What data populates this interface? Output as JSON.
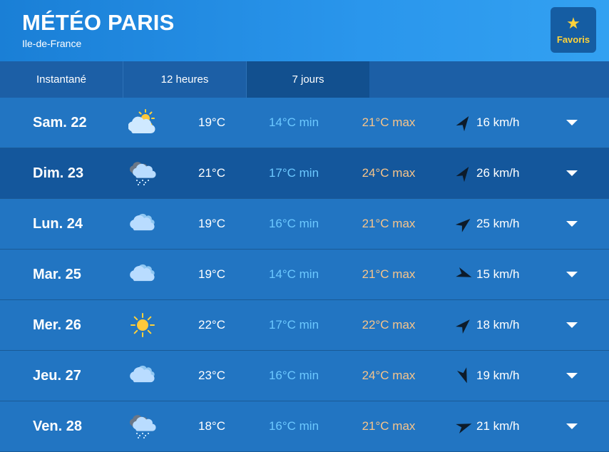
{
  "header": {
    "title": "MÉTÉO PARIS",
    "subtitle": "Ile-de-France",
    "favorite_label": "Favoris",
    "favorite_color": "#ffd23a"
  },
  "tabs": [
    {
      "label": "Instantané",
      "active": false
    },
    {
      "label": "12 heures",
      "active": false
    },
    {
      "label": "7 jours",
      "active": true
    }
  ],
  "days": [
    {
      "day": "Sam. 22",
      "icon": "sun-cloud-icon",
      "temp": "19°C",
      "min": "14°C min",
      "max": "21°C max",
      "wind": "16 km/h",
      "wind_dir_deg": 35
    },
    {
      "day": "Dim. 23",
      "icon": "cloud-rain-icon",
      "temp": "21°C",
      "min": "17°C min",
      "max": "24°C max",
      "wind": "26 km/h",
      "wind_dir_deg": 35
    },
    {
      "day": "Lun. 24",
      "icon": "cloud-icon",
      "temp": "19°C",
      "min": "16°C min",
      "max": "21°C max",
      "wind": "25 km/h",
      "wind_dir_deg": 50
    },
    {
      "day": "Mar. 25",
      "icon": "cloud-icon",
      "temp": "19°C",
      "min": "14°C min",
      "max": "21°C max",
      "wind": "15 km/h",
      "wind_dir_deg": 110
    },
    {
      "day": "Mer. 26",
      "icon": "sun-icon",
      "temp": "22°C",
      "min": "17°C min",
      "max": "22°C max",
      "wind": "18 km/h",
      "wind_dir_deg": 45
    },
    {
      "day": "Jeu. 27",
      "icon": "cloud-icon",
      "temp": "23°C",
      "min": "16°C min",
      "max": "24°C max",
      "wind": "19 km/h",
      "wind_dir_deg": 160
    },
    {
      "day": "Ven. 28",
      "icon": "cloud-rain-icon",
      "temp": "18°C",
      "min": "16°C min",
      "max": "21°C max",
      "wind": "21 km/h",
      "wind_dir_deg": 70
    }
  ],
  "colors": {
    "min_temp": "#6cc8ff",
    "max_temp": "#f6c48a",
    "row_highlight": "#14579c"
  }
}
